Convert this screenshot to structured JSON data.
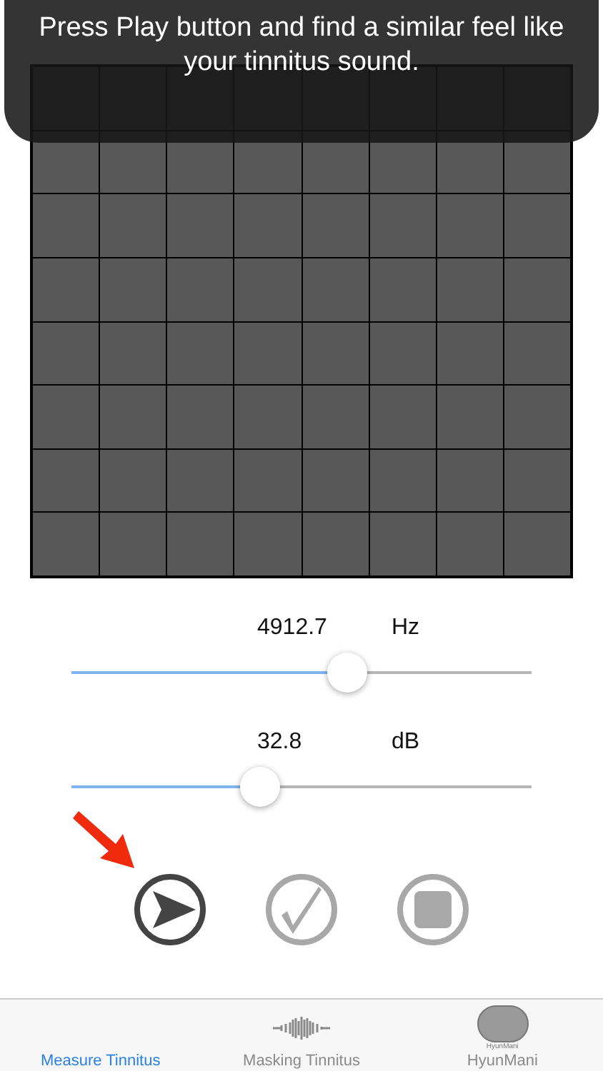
{
  "overlay": {
    "message": "Press Play button and find a similar feel like your tinnitus sound."
  },
  "sliders": [
    {
      "value": "4912.7",
      "unit": "Hz",
      "level": 0.6
    },
    {
      "value": "32.8",
      "unit": "dB",
      "level": 0.41
    }
  ],
  "controls": [
    {
      "kind": "play",
      "disabled": false
    },
    {
      "kind": "check",
      "disabled": true
    },
    {
      "kind": "stop",
      "disabled": true
    }
  ],
  "tabs": [
    {
      "label": "Measure Tinnitus",
      "kind": "measure",
      "selected": true
    },
    {
      "label": "Masking Tinnitus",
      "kind": "wave",
      "selected": false
    },
    {
      "label": "HyunMani",
      "kind": "logo",
      "logo_text": "HyunMani",
      "selected": false
    }
  ]
}
